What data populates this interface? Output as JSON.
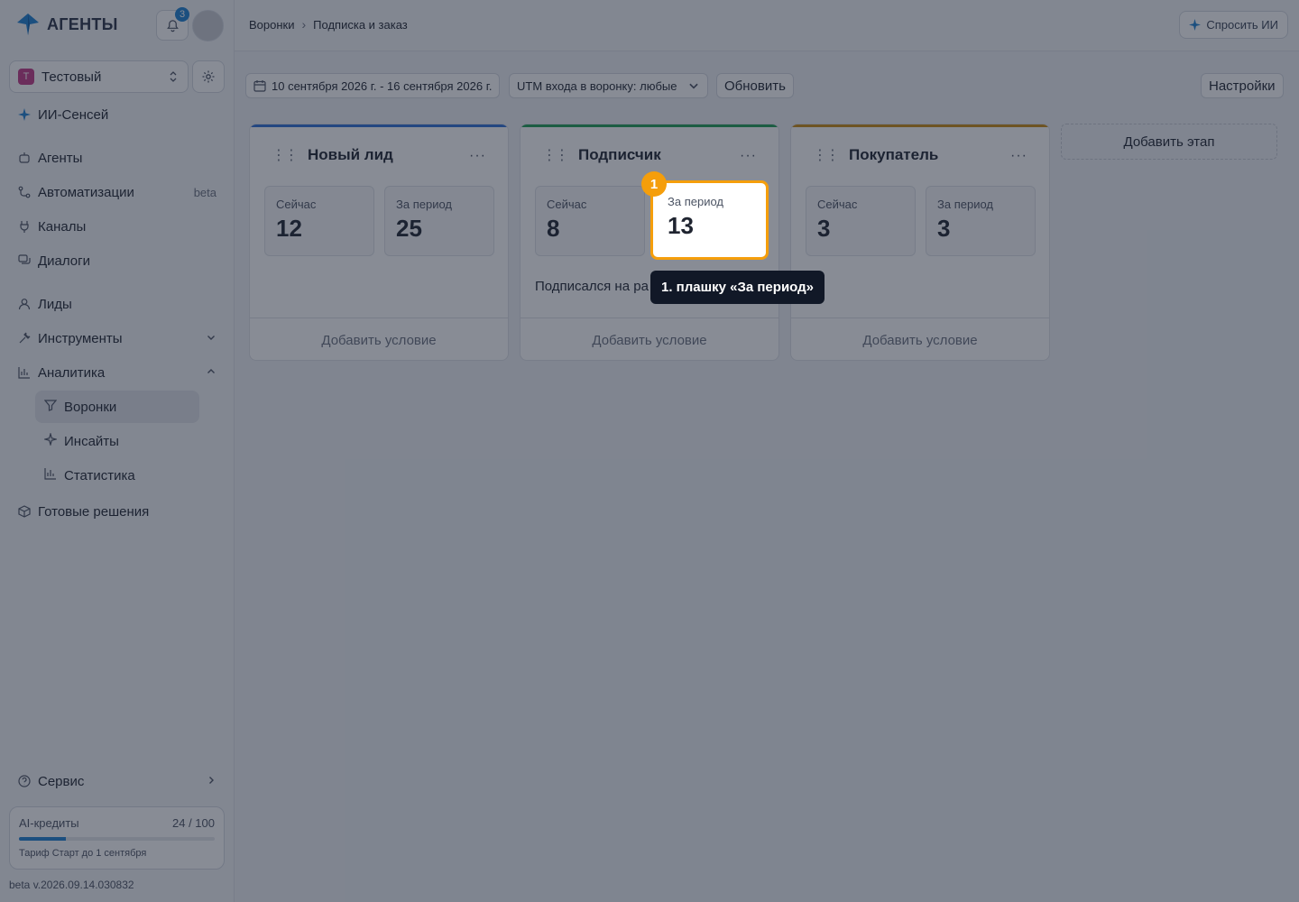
{
  "app": {
    "logo_text": "АГЕНТЫ",
    "notifications_count": "3"
  },
  "workspace": {
    "initial": "Т",
    "name": "Тестовый"
  },
  "sidebar": {
    "top_item": "ИИ-Сенсей",
    "items": [
      {
        "label": "Агенты",
        "icon": "robot-icon"
      },
      {
        "label": "Автоматизации",
        "badge": "beta",
        "icon": "branch-icon"
      },
      {
        "label": "Каналы",
        "icon": "plug-icon"
      },
      {
        "label": "Диалоги",
        "icon": "chat-icon"
      },
      {
        "label": "Лиды",
        "icon": "user-icon"
      },
      {
        "label": "Инструменты",
        "icon": "tools-icon"
      },
      {
        "label": "Аналитика",
        "icon": "chart-icon"
      }
    ],
    "analytics_sub": [
      {
        "label": "Воронки",
        "icon": "filter-icon"
      },
      {
        "label": "Инсайты",
        "icon": "sparkle-icon"
      },
      {
        "label": "Статистика",
        "icon": "bar-chart-icon"
      }
    ],
    "ready": "Готовые решения",
    "service": "Сервис"
  },
  "credits": {
    "label": "AI-кредиты",
    "used": 24,
    "total": 100,
    "value_text": "24 / 100",
    "plan": "Тариф Старт до 1 сентября"
  },
  "version": "beta v.2026.09.14.030832",
  "breadcrumb": {
    "root": "Воронки",
    "current": "Подписка и заказ"
  },
  "ask_ai": "Спросить ИИ",
  "toolbar": {
    "date_range": "10 сентября 2026 г. - 16 сентября 2026 г.",
    "utm": "UTM входа в воронку: любые",
    "refresh": "Обновить",
    "settings": "Настройки"
  },
  "stages": [
    {
      "title": "Новый лид",
      "color": "#2f6fd6",
      "now_label": "Сейчас",
      "now": "12",
      "period_label": "За период",
      "period": "25",
      "condition": "",
      "footer": "Добавить условие"
    },
    {
      "title": "Подписчик",
      "color": "#1f9d55",
      "now_label": "Сейчас",
      "now": "8",
      "period_label": "За период",
      "period": "13",
      "condition": "Подписался на ра",
      "footer": "Добавить условие"
    },
    {
      "title": "Покупатель",
      "color": "#c98a12",
      "now_label": "Сейчас",
      "now": "3",
      "period_label": "За период",
      "period": "3",
      "condition": "",
      "footer": "Добавить условие"
    }
  ],
  "add_stage": "Добавить этап",
  "tour": {
    "step": "1",
    "tooltip": "1. плашку «За период»"
  }
}
